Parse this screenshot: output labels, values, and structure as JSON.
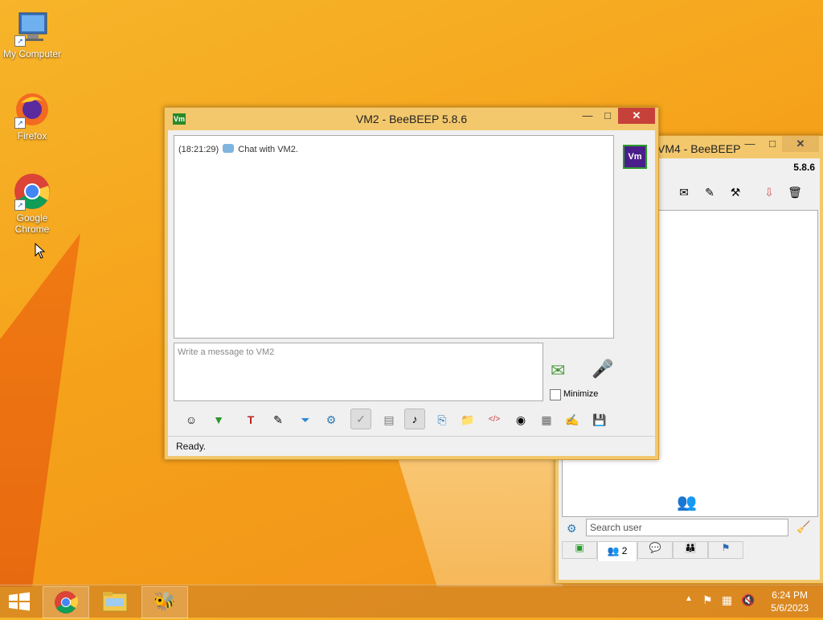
{
  "desktop": {
    "icons": [
      {
        "label": "My Computer",
        "icon": "computer-icon"
      },
      {
        "label": "Firefox",
        "icon": "firefox-icon"
      },
      {
        "label": "Google Chrome",
        "icon": "chrome-icon"
      }
    ]
  },
  "main_window": {
    "title": "VM2 - BeeBEEP 5.8.6",
    "app_badge": "Vm",
    "chat_timestamp": "(18:21:29)",
    "chat_message": "Chat with VM2.",
    "input_placeholder": "Write a message to VM2",
    "minimize_label": "Minimize",
    "status": "Ready."
  },
  "back_window": {
    "title": "VM4 - BeeBEEP",
    "version": "5.8.6",
    "search_placeholder": "Search user",
    "users_tab_count": "2"
  },
  "taskbar": {
    "time": "6:24 PM",
    "date": "5/6/2023"
  },
  "colors": {
    "accent": "#c7413b",
    "window_frame": "#f3c86c"
  }
}
